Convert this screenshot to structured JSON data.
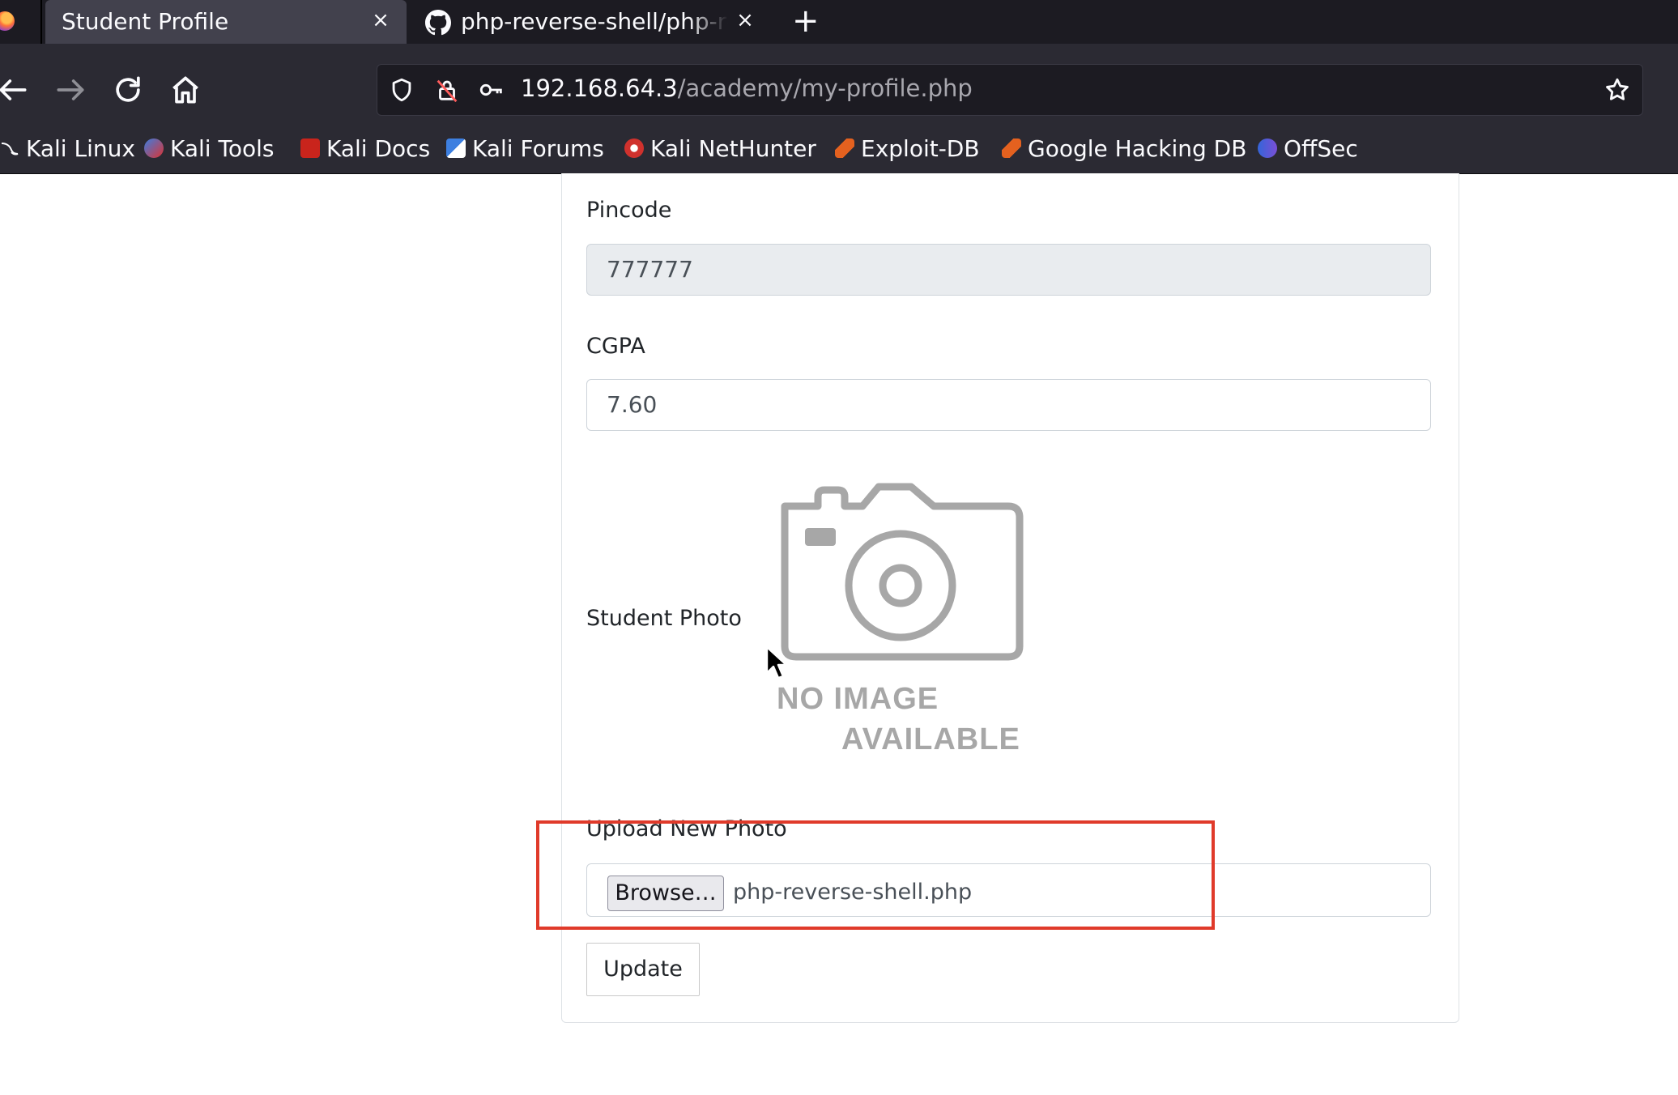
{
  "browser": {
    "tabs": [
      {
        "title": "Student Profile",
        "active": true
      },
      {
        "title": "php-reverse-shell/php-re",
        "active": false
      }
    ],
    "new_tab_label": "+",
    "close_glyph": "×",
    "url": {
      "host": "192.168.64.3",
      "path": "/academy/my-profile.php"
    },
    "bookmarks": [
      {
        "label": "Kali Linux",
        "icon": "kali-dragon-icon"
      },
      {
        "label": "Kali Tools",
        "icon": "kali-tools-icon"
      },
      {
        "label": "Kali Docs",
        "icon": "kali-docs-icon"
      },
      {
        "label": "Kali Forums",
        "icon": "kali-forums-icon"
      },
      {
        "label": "Kali NetHunter",
        "icon": "kali-nethunter-icon"
      },
      {
        "label": "Exploit-DB",
        "icon": "exploit-db-icon"
      },
      {
        "label": "Google Hacking DB",
        "icon": "ghdb-icon"
      },
      {
        "label": "OffSec",
        "icon": "offsec-icon"
      }
    ]
  },
  "form": {
    "pincode": {
      "label": "Pincode",
      "value": "777777"
    },
    "cgpa": {
      "label": "CGPA",
      "value": "7.60"
    },
    "photo": {
      "label": "Student Photo",
      "placeholder_line1": "NO IMAGE",
      "placeholder_line2": "AVAILABLE"
    },
    "upload": {
      "label": "Upload New Photo",
      "browse_label": "Browse…",
      "file_name": "php-reverse-shell.php"
    },
    "update_label": "Update"
  },
  "colors": {
    "highlight": "#e03a2a",
    "chrome_dark": "#1c1b22",
    "toolbar": "#2b2a33"
  }
}
